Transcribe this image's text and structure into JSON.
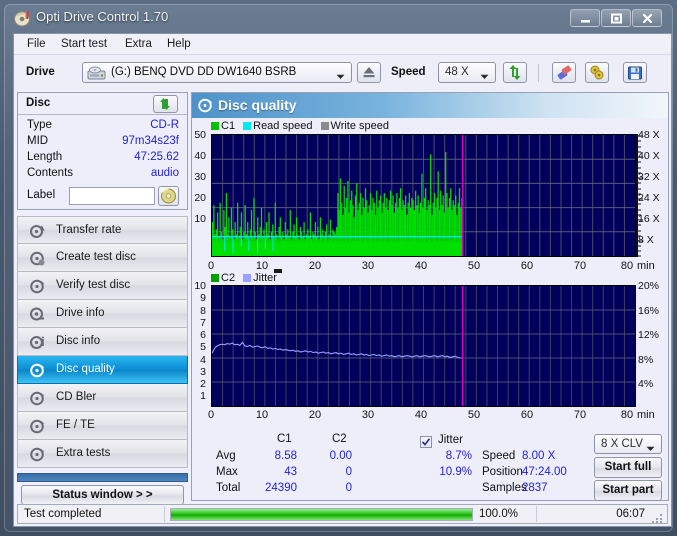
{
  "window": {
    "title": "Opti Drive Control 1.70",
    "icon": "disc-icon",
    "buttons": {
      "minimize": "minimize-icon",
      "maximize": "maximize-icon",
      "close": "close-icon"
    }
  },
  "menu": {
    "items": [
      "File",
      "Start test",
      "Extra",
      "Help"
    ]
  },
  "toolbar": {
    "drive_label": "Drive",
    "drive_value": "(G:)  BENQ DVD DD DW1640 BSRB",
    "eject_icon": "eject-icon",
    "speed_label": "Speed",
    "speed_value": "48 X",
    "refresh_icon": "refresh-icon",
    "erase_icon": "erase-icon",
    "bookmark_icon": "bookmark-icon",
    "save_icon": "save-icon"
  },
  "disc_panel": {
    "title": "Disc",
    "refresh_icon": "refresh-icon",
    "rows": [
      {
        "key": "Type",
        "value": "CD-R"
      },
      {
        "key": "MID",
        "value": "97m34s23f"
      },
      {
        "key": "Length",
        "value": "47:25.62"
      },
      {
        "key": "Contents",
        "value": "audio"
      }
    ],
    "label_key": "Label",
    "label_value": "",
    "label_button_icon": "cd-icon"
  },
  "nav": {
    "items": [
      {
        "label": "Transfer rate",
        "icon": "transfer-rate-icon",
        "selected": false
      },
      {
        "label": "Create test disc",
        "icon": "create-disc-icon",
        "selected": false
      },
      {
        "label": "Verify test disc",
        "icon": "verify-disc-icon",
        "selected": false
      },
      {
        "label": "Drive info",
        "icon": "drive-info-icon",
        "selected": false
      },
      {
        "label": "Disc info",
        "icon": "disc-info-icon",
        "selected": false
      },
      {
        "label": "Disc quality",
        "icon": "disc-quality-icon",
        "selected": true
      },
      {
        "label": "CD Bler",
        "icon": "cd-bler-icon",
        "selected": false
      },
      {
        "label": "FE / TE",
        "icon": "fe-te-icon",
        "selected": false
      },
      {
        "label": "Extra tests",
        "icon": "extra-tests-icon",
        "selected": false
      }
    ],
    "status_window_button": "Status window > >"
  },
  "panel": {
    "header_title": "Disc quality",
    "header_icon": "disc-quality-icon"
  },
  "stats": {
    "col_c1": "C1",
    "col_c2": "C2",
    "rows": [
      {
        "name": "Avg",
        "c1": "8.58",
        "c2": "0.00"
      },
      {
        "name": "Max",
        "c1": "43",
        "c2": "0"
      },
      {
        "name": "Total",
        "c1": "24390",
        "c2": "0"
      }
    ],
    "jitter_label": "Jitter",
    "jitter_checked": true,
    "jitter_avg": "8.7%",
    "jitter_max": "10.9%",
    "speed_label": "Speed",
    "speed_value": "8.00 X",
    "position_label": "Position",
    "position_value": "47:24.00",
    "samples_label": "Samples",
    "samples_value": "2837",
    "clv_value": "8 X CLV",
    "start_full": "Start full",
    "start_part": "Start part"
  },
  "statusbar": {
    "message": "Test completed",
    "percent": "100.0%",
    "progress": 100,
    "time": "06:07"
  },
  "colors": {
    "c1": "#00e000",
    "read_speed": "#00e8f0",
    "write_speed": "#8a8a8a",
    "c2": "#00a000",
    "jitter": "#9aa0ff",
    "plot_bg": "#00005c",
    "marker": "#e000c0",
    "accent": "#0c8fd4"
  },
  "chart_data": [
    {
      "type": "bar",
      "name": "c1-chart",
      "title": "",
      "legend": [
        {
          "label": "C1",
          "color": "#00c000"
        },
        {
          "label": "Read speed",
          "color": "#00e8f0"
        },
        {
          "label": "Write speed",
          "color": "#8a8a8a"
        }
      ],
      "legend_position": "top-left",
      "xlabel": "min",
      "xlim": [
        0,
        80
      ],
      "xticks": [
        0,
        10,
        20,
        30,
        40,
        50,
        60,
        70,
        80
      ],
      "ylabel_left": "C1",
      "ylim": [
        0,
        50
      ],
      "yticks_left": [
        10,
        20,
        30,
        40,
        50
      ],
      "ylabel_right": "speed",
      "ylim_right": [
        0,
        50
      ],
      "yticks_right": [
        "8 X",
        "16 X",
        "24 X",
        "32 X",
        "40 X",
        "48 X"
      ],
      "grid": true,
      "data_end_x": 47.4,
      "marker_x": 47.4,
      "series": [
        {
          "name": "C1",
          "color": "#00e000",
          "x_start": 0,
          "x_end": 47.4,
          "values": [
            14,
            21,
            9,
            11,
            18,
            8,
            22,
            10,
            7,
            19,
            12,
            26,
            9,
            16,
            8,
            20,
            11,
            7,
            14,
            9,
            22,
            8,
            12,
            18,
            7,
            10,
            21,
            9,
            14,
            7,
            11,
            19,
            8,
            24,
            10,
            7,
            16,
            9,
            12,
            20,
            8,
            11,
            7,
            14,
            9,
            18,
            7,
            10,
            13,
            8,
            22,
            9,
            7,
            12,
            16,
            8,
            10,
            7,
            14,
            9,
            11,
            8,
            19,
            7,
            10,
            13,
            8,
            16,
            9,
            7,
            12,
            10,
            8,
            14,
            7,
            9,
            11,
            8,
            18,
            7,
            10,
            9,
            14,
            8,
            12,
            7,
            16,
            9,
            11,
            8,
            10,
            13,
            7,
            9,
            15,
            8,
            11,
            10,
            9,
            12,
            26,
            19,
            32,
            22,
            17,
            29,
            20,
            24,
            31,
            18,
            23,
            27,
            21,
            16,
            25,
            30,
            19,
            22,
            26,
            17,
            24,
            20,
            28,
            23,
            18,
            21,
            26,
            19,
            24,
            22,
            17,
            27,
            20,
            23,
            25,
            18,
            22,
            26,
            20,
            24,
            19,
            23,
            27,
            21,
            25,
            18,
            22,
            26,
            20,
            24,
            28,
            19,
            23,
            21,
            25,
            17,
            22,
            26,
            20,
            24,
            23,
            19,
            27,
            21,
            25,
            18,
            22,
            34,
            20,
            24,
            28,
            19,
            23,
            21,
            42,
            17,
            22,
            26,
            20,
            24,
            35,
            19,
            27,
            21,
            25,
            18,
            43,
            26,
            20,
            24,
            28,
            19,
            23,
            21,
            25,
            17,
            22,
            28,
            20,
            24
          ]
        },
        {
          "name": "Read speed",
          "color": "#00e8f0",
          "x_start": 0,
          "x_end": 47.4,
          "constant_value": 8,
          "note": "flat read speed trace at about 8 X with a few downward dropouts before 12 min"
        }
      ]
    },
    {
      "type": "line",
      "name": "c2-jitter-chart",
      "title": "",
      "legend": [
        {
          "label": "C2",
          "color": "#00a000"
        },
        {
          "label": "Jitter",
          "color": "#9aa0ff"
        }
      ],
      "legend_position": "top-left",
      "xlabel": "min",
      "xlim": [
        0,
        80
      ],
      "xticks": [
        0,
        10,
        20,
        30,
        40,
        50,
        60,
        70,
        80
      ],
      "ylabel_left": "C2",
      "ylim": [
        0,
        10
      ],
      "yticks_left": [
        1,
        2,
        3,
        4,
        5,
        6,
        7,
        8,
        9,
        10
      ],
      "ylabel_right": "Jitter",
      "ylim_right": [
        0,
        20
      ],
      "yticks_right": [
        "4%",
        "8%",
        "12%",
        "16%",
        "20%"
      ],
      "grid": true,
      "data_end_x": 47.4,
      "marker_x": 47.4,
      "series": [
        {
          "name": "C2",
          "color": "#00a000",
          "values": [],
          "note": "no C2 errors recorded - flat at zero"
        },
        {
          "name": "Jitter",
          "color": "#9aa0ff",
          "x_start": 0,
          "x_end": 47.4,
          "unit": "percent-right-axis",
          "values": [
            8.8,
            9.6,
            10.0,
            10.2,
            10.3,
            10.2,
            10.4,
            10.3,
            10.5,
            10.2,
            10.3,
            10.1,
            10.6,
            10.0,
            9.9,
            10.1,
            9.8,
            9.9,
            10.0,
            9.8,
            9.7,
            9.9,
            9.6,
            9.7,
            9.5,
            9.6,
            9.4,
            9.5,
            9.3,
            9.4,
            9.3,
            9.2,
            9.3,
            9.1,
            9.2,
            9.0,
            9.1,
            9.2,
            9.0,
            9.1,
            8.9,
            9.0,
            8.8,
            8.9,
            9.0,
            8.8,
            8.9,
            8.7,
            8.8,
            8.9,
            8.7,
            8.8,
            8.6,
            8.7,
            8.8,
            8.6,
            8.7,
            8.5,
            8.6,
            8.7,
            8.5,
            8.6,
            8.4,
            8.5,
            8.6,
            8.4,
            8.5,
            8.3,
            8.4,
            8.5,
            8.3,
            8.4,
            8.2,
            8.3,
            8.4,
            8.2,
            8.3,
            8.4,
            8.3,
            8.2,
            8.3,
            8.4,
            8.2,
            8.3,
            8.4,
            8.3,
            8.2,
            8.3,
            8.4,
            8.2,
            8.3,
            8.4,
            8.2,
            8.3,
            8.1,
            8.2,
            8.3,
            8.1,
            8.0,
            8.0
          ]
        }
      ]
    }
  ]
}
